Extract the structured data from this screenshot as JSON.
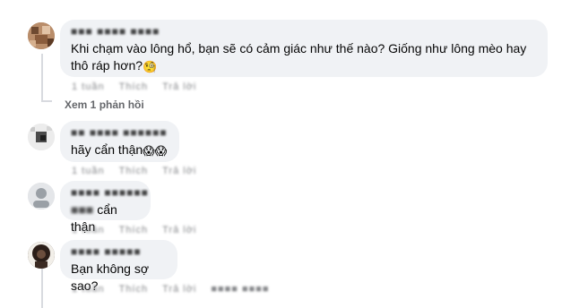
{
  "comments": [
    {
      "author": "■■■ ■■■■ ■■■■",
      "text": "Khi chạm vào lông hổ, bạn sẽ có cảm giác như thế nào? Giống như lông mèo hay thô ráp hơn?",
      "emoji": "🧐",
      "meta": [
        "1 tuần",
        "Thích",
        "Trả lời"
      ],
      "replies_label": "Xem 1 phản hồi",
      "avatar_color": "#8a6a4e"
    },
    {
      "author": "■■ ■■■■ ■■■■■■",
      "text": "hãy cẩn thận",
      "emoji": "😱😱",
      "meta": [
        "1 tuần",
        "Thích",
        "Trả lời"
      ],
      "avatar_color": "#6b6b6b"
    },
    {
      "author": "■■■■ ■■■■■■",
      "prefix": "■■■",
      "text": "cẩn thận",
      "meta": [
        "1 tuần",
        "Thích",
        "Trả lời"
      ],
      "avatar_color": "#9aa0a6"
    },
    {
      "author": "■■■■ ■■■■■",
      "text": "Bạn không sợ sao?",
      "meta": [
        "1 tuần",
        "Thích",
        "Trả lời",
        "■■■■ ■■■■"
      ],
      "avatar_color": "#3a2a22"
    }
  ]
}
